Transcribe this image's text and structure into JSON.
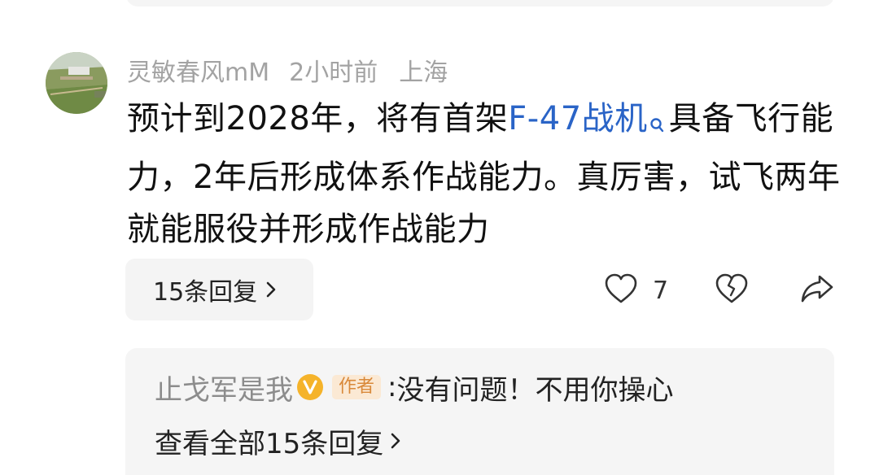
{
  "comment": {
    "username": "灵敏春风mM",
    "time": "2小时前",
    "location": "上海",
    "text_before": "预计到2028年，将有首架",
    "link_text": "F-47战机",
    "text_after": "具备飞行能力，2年后形成体系作战能力。真厉害，试飞两年就能服役并形成作战能力",
    "replies_label": "15条回复",
    "like_count": "7",
    "link_color": "#2a64c7"
  },
  "reply_preview": {
    "username": "止戈军是我",
    "author_tag": "作者",
    "colon": ":",
    "text": "没有问题！不用你操心",
    "view_all_label": "查看全部15条回复"
  },
  "icons": {
    "avatar": "avatar-photo",
    "search": "search-icon",
    "chevron": "chevron-right-icon",
    "like": "heart-icon",
    "dislike": "broken-heart-icon",
    "share": "share-arrow-icon",
    "badge": "vip-badge-icon"
  },
  "colors": {
    "accent_blue": "#2a64c7",
    "badge_yellow": "#f5b32a",
    "author_tag_text": "#d9893a",
    "author_tag_bg": "#fbe9d4"
  }
}
